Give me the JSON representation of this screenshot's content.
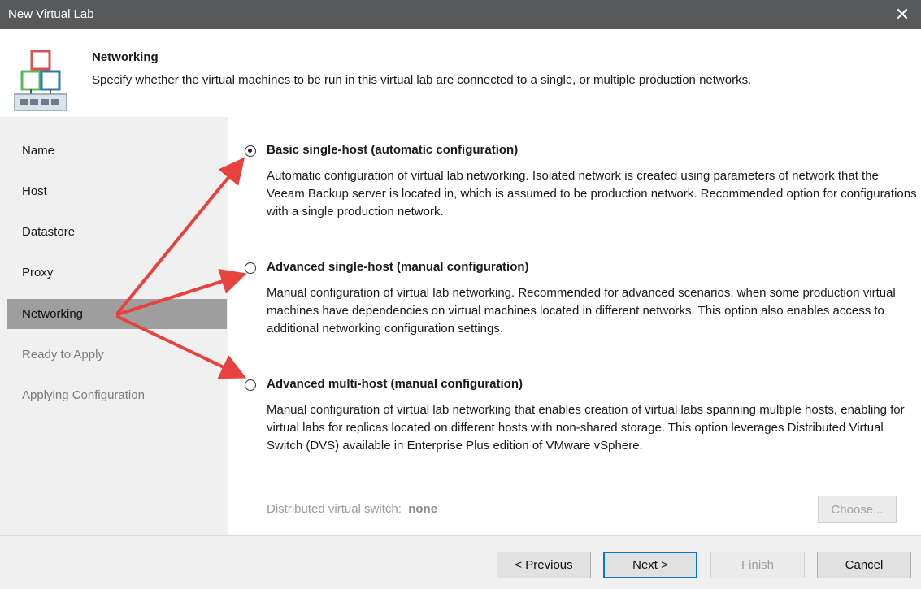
{
  "window": {
    "title": "New Virtual Lab",
    "close_glyph": "✕"
  },
  "header": {
    "title": "Networking",
    "description": "Specify whether the virtual machines to be run in this virtual lab are connected to a single, or multiple production networks."
  },
  "sidebar": {
    "items": [
      {
        "label": "Name",
        "state": "normal"
      },
      {
        "label": "Host",
        "state": "normal"
      },
      {
        "label": "Datastore",
        "state": "normal"
      },
      {
        "label": "Proxy",
        "state": "normal"
      },
      {
        "label": "Networking",
        "state": "active"
      },
      {
        "label": "Ready to Apply",
        "state": "disabled"
      },
      {
        "label": "Applying Configuration",
        "state": "disabled"
      }
    ]
  },
  "options": [
    {
      "label": "Basic single-host (automatic configuration)",
      "selected": true,
      "description": "Automatic configuration of virtual lab networking. Isolated network is created using parameters of network that the Veeam Backup server is located in, which is assumed to be production network. Recommended option for configurations with a single production network."
    },
    {
      "label": "Advanced single-host (manual configuration)",
      "selected": false,
      "description": "Manual configuration of virtual lab networking. Recommended for advanced scenarios, when some production virtual machines have dependencies on virtual machines located in different networks. This option also enables access to additional networking configuration settings."
    },
    {
      "label": "Advanced multi-host (manual configuration)",
      "selected": false,
      "description": "Manual configuration of virtual lab networking that enables creation of virtual labs spanning multiple hosts, enabling for virtual labs for replicas located on different hosts with non-shared storage. This option leverages Distributed Virtual Switch (DVS) available in Enterprise Plus edition of VMware vSphere."
    }
  ],
  "dvs": {
    "label": "Distributed virtual switch:",
    "value": "none",
    "choose_label": "Choose..."
  },
  "footer": {
    "previous": "< Previous",
    "next": "Next >",
    "finish": "Finish",
    "cancel": "Cancel"
  },
  "colors": {
    "titlebar": "#58595b",
    "sidebar": "#f0f0f0",
    "active_item": "#9e9e9e",
    "arrow": "#e8423f",
    "default_button_border": "#0078d7"
  }
}
